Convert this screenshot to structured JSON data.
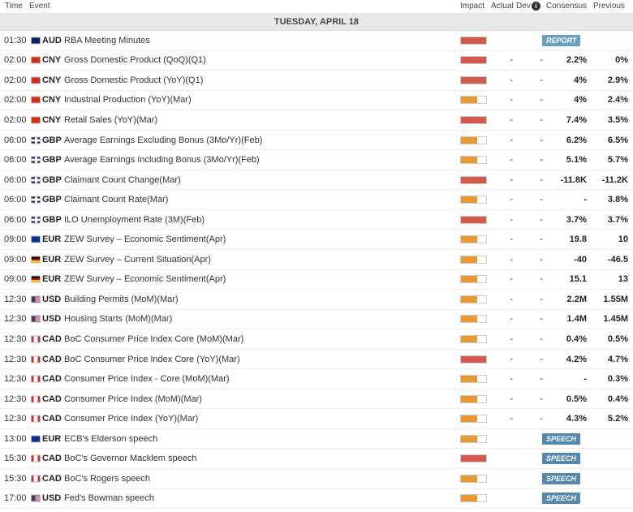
{
  "header": {
    "time": "Time",
    "event": "Event",
    "impact": "Impact",
    "actual": "Actual",
    "dev": "Dev",
    "info_icon": "i",
    "consensus": "Consensus",
    "previous": "Previous"
  },
  "date_label": "TUESDAY, APRIL 18",
  "colors": {
    "high": "#d35a4a",
    "medium": "#e8992f",
    "flag_border": "#bbbbbb"
  },
  "rows": [
    {
      "time": "01:30",
      "flag": "au-flag-icon",
      "currency": "AUD",
      "event": "RBA Meeting Minutes",
      "impact": "high",
      "actual": "",
      "dev": "",
      "consensus": "",
      "previous": "",
      "badge": "REPORT"
    },
    {
      "time": "02:00",
      "flag": "cn-flag-icon",
      "currency": "CNY",
      "event": "Gross Domestic Product (QoQ)(Q1)",
      "impact": "high",
      "actual": "-",
      "dev": "-",
      "consensus": "2.2%",
      "previous": "0%"
    },
    {
      "time": "02:00",
      "flag": "cn-flag-icon",
      "currency": "CNY",
      "event": "Gross Domestic Product (YoY)(Q1)",
      "impact": "high",
      "actual": "-",
      "dev": "-",
      "consensus": "4%",
      "previous": "2.9%"
    },
    {
      "time": "02:00",
      "flag": "cn-flag-icon",
      "currency": "CNY",
      "event": "Industrial Production (YoY)(Mar)",
      "impact": "medium",
      "actual": "-",
      "dev": "-",
      "consensus": "4%",
      "previous": "2.4%"
    },
    {
      "time": "02:00",
      "flag": "cn-flag-icon",
      "currency": "CNY",
      "event": "Retail Sales (YoY)(Mar)",
      "impact": "high",
      "actual": "-",
      "dev": "-",
      "consensus": "7.4%",
      "previous": "3.5%"
    },
    {
      "time": "06:00",
      "flag": "gb-flag-icon",
      "currency": "GBP",
      "event": "Average Earnings Excluding Bonus (3Mo/Yr)(Feb)",
      "impact": "medium",
      "actual": "-",
      "dev": "-",
      "consensus": "6.2%",
      "previous": "6.5%"
    },
    {
      "time": "06:00",
      "flag": "gb-flag-icon",
      "currency": "GBP",
      "event": "Average Earnings Including Bonus (3Mo/Yr)(Feb)",
      "impact": "medium",
      "actual": "-",
      "dev": "-",
      "consensus": "5.1%",
      "previous": "5.7%"
    },
    {
      "time": "06:00",
      "flag": "gb-flag-icon",
      "currency": "GBP",
      "event": "Claimant Count Change(Mar)",
      "impact": "high",
      "actual": "-",
      "dev": "-",
      "consensus": "-11.8K",
      "previous": "-11.2K"
    },
    {
      "time": "06:00",
      "flag": "gb-flag-icon",
      "currency": "GBP",
      "event": "Claimant Count Rate(Mar)",
      "impact": "medium",
      "actual": "-",
      "dev": "-",
      "consensus": "-",
      "previous": "3.8%"
    },
    {
      "time": "06:00",
      "flag": "gb-flag-icon",
      "currency": "GBP",
      "event": "ILO Unemployment Rate (3M)(Feb)",
      "impact": "high",
      "actual": "-",
      "dev": "-",
      "consensus": "3.7%",
      "previous": "3.7%"
    },
    {
      "time": "09:00",
      "flag": "eu-flag-icon",
      "currency": "EUR",
      "event": "ZEW Survey – Economic Sentiment(Apr)",
      "impact": "medium",
      "actual": "-",
      "dev": "-",
      "consensus": "19.8",
      "previous": "10"
    },
    {
      "time": "09:00",
      "flag": "de-flag-icon",
      "currency": "EUR",
      "event": "ZEW Survey – Current Situation(Apr)",
      "impact": "medium",
      "actual": "-",
      "dev": "-",
      "consensus": "-40",
      "previous": "-46.5"
    },
    {
      "time": "09:00",
      "flag": "de-flag-icon",
      "currency": "EUR",
      "event": "ZEW Survey – Economic Sentiment(Apr)",
      "impact": "medium",
      "actual": "-",
      "dev": "-",
      "consensus": "15.1",
      "previous": "13"
    },
    {
      "time": "12:30",
      "flag": "us-flag-icon",
      "currency": "USD",
      "event": "Building Permits (MoM)(Mar)",
      "impact": "medium",
      "actual": "-",
      "dev": "-",
      "consensus": "2.2M",
      "previous": "1.55M"
    },
    {
      "time": "12:30",
      "flag": "us-flag-icon",
      "currency": "USD",
      "event": "Housing Starts (MoM)(Mar)",
      "impact": "medium",
      "actual": "-",
      "dev": "-",
      "consensus": "1.4M",
      "previous": "1.45M"
    },
    {
      "time": "12:30",
      "flag": "ca-flag-icon",
      "currency": "CAD",
      "event": "BoC Consumer Price Index Core (MoM)(Mar)",
      "impact": "medium",
      "actual": "-",
      "dev": "-",
      "consensus": "0.4%",
      "previous": "0.5%"
    },
    {
      "time": "12:30",
      "flag": "ca-flag-icon",
      "currency": "CAD",
      "event": "BoC Consumer Price Index Core (YoY)(Mar)",
      "impact": "high",
      "actual": "-",
      "dev": "-",
      "consensus": "4.2%",
      "previous": "4.7%"
    },
    {
      "time": "12:30",
      "flag": "ca-flag-icon",
      "currency": "CAD",
      "event": "Consumer Price Index - Core (MoM)(Mar)",
      "impact": "medium",
      "actual": "-",
      "dev": "-",
      "consensus": "-",
      "previous": "0.3%"
    },
    {
      "time": "12:30",
      "flag": "ca-flag-icon",
      "currency": "CAD",
      "event": "Consumer Price Index (MoM)(Mar)",
      "impact": "medium",
      "actual": "-",
      "dev": "-",
      "consensus": "0.5%",
      "previous": "0.4%"
    },
    {
      "time": "12:30",
      "flag": "ca-flag-icon",
      "currency": "CAD",
      "event": "Consumer Price Index (YoY)(Mar)",
      "impact": "medium",
      "actual": "-",
      "dev": "-",
      "consensus": "4.3%",
      "previous": "5.2%"
    },
    {
      "time": "13:00",
      "flag": "eu-flag-icon",
      "currency": "EUR",
      "event": "ECB's Elderson speech",
      "impact": "medium",
      "actual": "",
      "dev": "",
      "consensus": "",
      "previous": "",
      "badge": "SPEECH"
    },
    {
      "time": "15:30",
      "flag": "ca-flag-icon",
      "currency": "CAD",
      "event": "BoC's Governor Macklem speech",
      "impact": "high",
      "actual": "",
      "dev": "",
      "consensus": "",
      "previous": "",
      "badge": "SPEECH"
    },
    {
      "time": "15:30",
      "flag": "ca-flag-icon",
      "currency": "CAD",
      "event": "BoC's Rogers speech",
      "impact": "medium",
      "actual": "",
      "dev": "",
      "consensus": "",
      "previous": "",
      "badge": "SPEECH"
    },
    {
      "time": "17:00",
      "flag": "us-flag-icon",
      "currency": "USD",
      "event": "Fed's Bowman speech",
      "impact": "medium",
      "actual": "",
      "dev": "",
      "consensus": "",
      "previous": "",
      "badge": "SPEECH"
    }
  ]
}
